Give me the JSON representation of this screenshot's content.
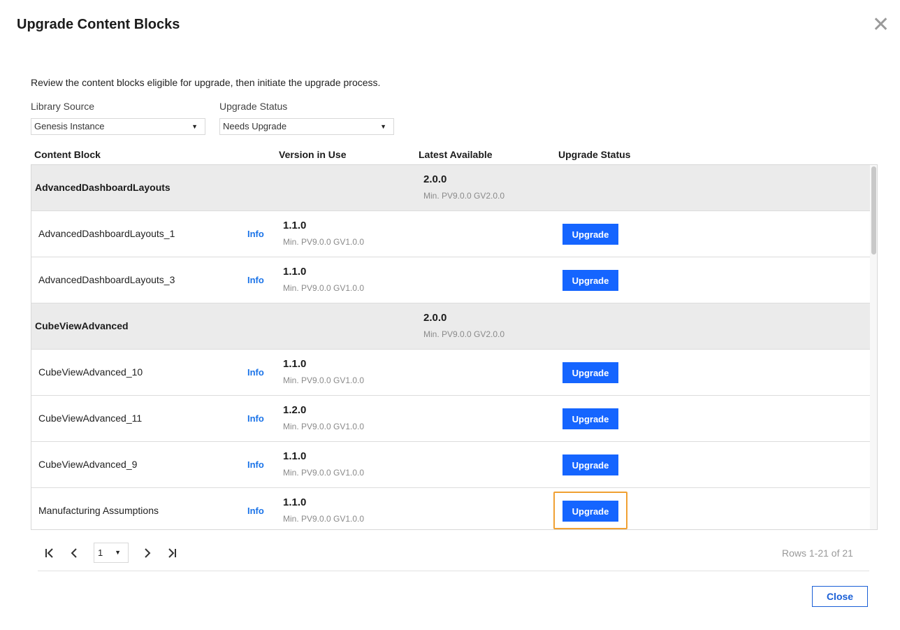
{
  "dialog": {
    "title": "Upgrade Content Blocks",
    "close_icon": "close-x-icon",
    "description": "Review the content blocks eligible for upgrade, then initiate the upgrade process."
  },
  "filters": {
    "library_source_label": "Library Source",
    "library_source_value": "Genesis Instance",
    "upgrade_status_label": "Upgrade Status",
    "upgrade_status_value": "Needs Upgrade"
  },
  "table": {
    "columns": [
      "Content Block",
      "Version in Use",
      "Latest Available",
      "Upgrade Status"
    ],
    "rows": [
      {
        "type": "group",
        "name": "AdvancedDashboardLayouts",
        "latest": "2.0.0",
        "latest_min": "Min. PV9.0.0 GV2.0.0"
      },
      {
        "type": "item",
        "name": "AdvancedDashboardLayouts_1",
        "info": "Info",
        "version": "1.1.0",
        "version_min": "Min. PV9.0.0 GV1.0.0",
        "action": "Upgrade"
      },
      {
        "type": "item",
        "name": "AdvancedDashboardLayouts_3",
        "info": "Info",
        "version": "1.1.0",
        "version_min": "Min. PV9.0.0 GV1.0.0",
        "action": "Upgrade"
      },
      {
        "type": "group",
        "name": "CubeViewAdvanced",
        "latest": "2.0.0",
        "latest_min": "Min. PV9.0.0 GV2.0.0"
      },
      {
        "type": "item",
        "name": "CubeViewAdvanced_10",
        "info": "Info",
        "version": "1.1.0",
        "version_min": "Min. PV9.0.0 GV1.0.0",
        "action": "Upgrade"
      },
      {
        "type": "item",
        "name": "CubeViewAdvanced_11",
        "info": "Info",
        "version": "1.2.0",
        "version_min": "Min. PV9.0.0 GV1.0.0",
        "action": "Upgrade"
      },
      {
        "type": "item",
        "name": "CubeViewAdvanced_9",
        "info": "Info",
        "version": "1.1.0",
        "version_min": "Min. PV9.0.0 GV1.0.0",
        "action": "Upgrade"
      },
      {
        "type": "item",
        "name": "Manufacturing Assumptions",
        "info": "Info",
        "version": "1.1.0",
        "version_min": "Min. PV9.0.0 GV1.0.0",
        "action": "Upgrade",
        "focused": true
      }
    ]
  },
  "pagination": {
    "current_page": "1",
    "rows_info": "Rows 1-21 of 21",
    "icons": [
      "first-page-icon",
      "prev-page-icon",
      "next-page-icon",
      "last-page-icon"
    ]
  },
  "footer": {
    "close_label": "Close"
  },
  "colors": {
    "primary_button": "#1565ff",
    "link": "#1a73e8",
    "focus_ring": "#f0a032",
    "group_row_bg": "#ebebeb"
  }
}
